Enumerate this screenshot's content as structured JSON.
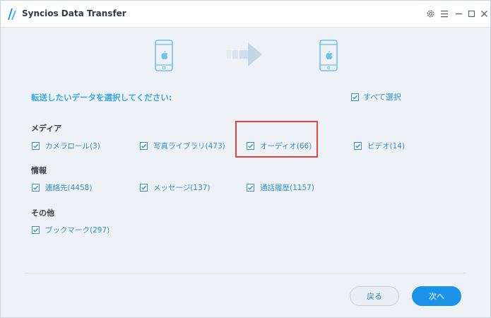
{
  "window": {
    "title": "Syncios Data Transfer",
    "controls": [
      "settings-icon",
      "menu-icon",
      "minimize-icon",
      "maximize-icon",
      "close-icon"
    ]
  },
  "transfer": {
    "source_icon": "phone-apple-icon",
    "target_icon": "phone-apple-icon",
    "direction_icon": "arrow-right-icon"
  },
  "instruction": "転送したいデータを選択してください:",
  "select_all": {
    "label": "すべて選択",
    "checked": true
  },
  "groups": [
    {
      "title": "メディア",
      "items": [
        {
          "label": "カメラロール(3)",
          "checked": true
        },
        {
          "label": "写真ライブラリ(473)",
          "checked": true
        },
        {
          "label": "オーディオ(66)",
          "checked": true,
          "highlighted": true
        },
        {
          "label": "ビデオ(14)",
          "checked": true
        }
      ]
    },
    {
      "title": "情報",
      "items": [
        {
          "label": "連絡先(4458)",
          "checked": true
        },
        {
          "label": "メッセージ(137)",
          "checked": true
        },
        {
          "label": "通話履歴(1157)",
          "checked": true
        }
      ]
    },
    {
      "title": "その他",
      "items": [
        {
          "label": "ブックマーク(297)",
          "checked": true
        }
      ]
    }
  ],
  "buttons": {
    "back": "戻る",
    "next": "次へ"
  },
  "colors": {
    "accent": "#2f90d4",
    "primary_button": "#1a93e8",
    "highlight_box": "#e0453f",
    "background": "#eef2f7"
  }
}
